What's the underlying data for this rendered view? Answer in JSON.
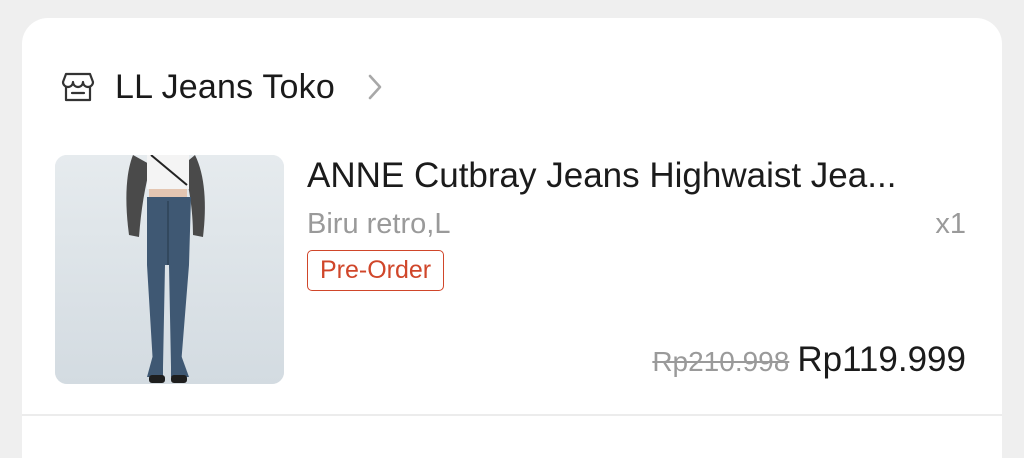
{
  "shop": {
    "name": "LL Jeans Toko",
    "icon": "store-icon",
    "chevron_icon": "chevron-right-icon"
  },
  "product": {
    "image": "product-image",
    "title": "ANNE Cutbray Jeans Highwaist Jea...",
    "variant": "Biru retro,L",
    "quantity": "x1",
    "badge": "Pre-Order",
    "original_price": "Rp210.998",
    "price": "Rp119.999"
  },
  "colors": {
    "badge": "#d0462a",
    "muted_text": "#9a9a9a",
    "primary_text": "#1b1b1b",
    "page_bg": "#efefef"
  }
}
